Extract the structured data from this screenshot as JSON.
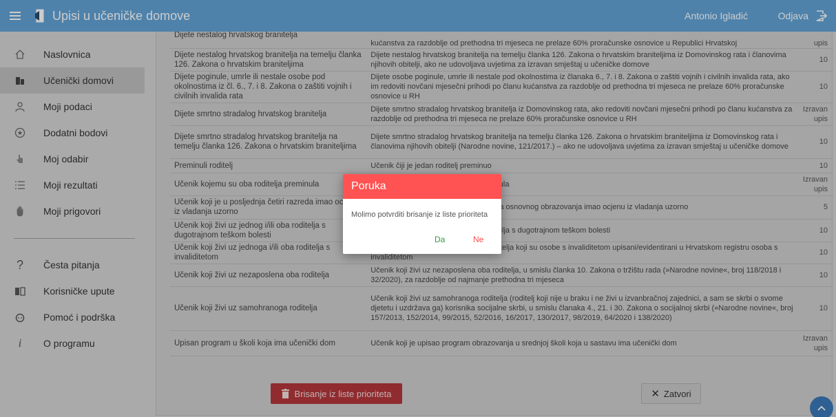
{
  "header": {
    "title": "Upisi u učeničke domove",
    "user": "Antonio Igladić",
    "logout": "Odjava"
  },
  "sidebar": {
    "items": [
      {
        "label": "Naslovnica",
        "icon": "home-icon"
      },
      {
        "label": "Učenički domovi",
        "icon": "building-icon",
        "active": true
      },
      {
        "label": "Moji podaci",
        "icon": "user-icon"
      },
      {
        "label": "Dodatni bodovi",
        "icon": "star-shield-icon"
      },
      {
        "label": "Moj odabir",
        "icon": "hand-pointer-icon"
      },
      {
        "label": "Moji rezultati",
        "icon": "list-icon"
      },
      {
        "label": "Moji prigovori",
        "icon": "raised-hand-icon"
      },
      {
        "label": "Česta pitanja",
        "icon": "question-icon"
      },
      {
        "label": "Korisničke upute",
        "icon": "book-icon"
      },
      {
        "label": "Pomoć i podrška",
        "icon": "support-icon"
      },
      {
        "label": "O programu",
        "icon": "info-icon"
      }
    ]
  },
  "table": {
    "rows": [
      {
        "c1": "Dijete nestalog hrvatskog branitelja",
        "c2": "kućanstva za razdoblje od prethodna tri mjeseca ne prelaze 60% proračunske osnovice u Republici Hrvatskoj",
        "c3": "upis"
      },
      {
        "c1": "Dijete nestalog hrvatskog branitelja na temelju članka 126. Zakona o hrvatskim braniteljima",
        "c2": "Dijete nestalog hrvatskog branitelja na temelju članka 126. Zakona o hrvatskim braniteljima iz Domovinskog rata i članovima njihovih obitelji, ako ne udovoljava uvjetima za izravan smještaj u učeničke domove",
        "c3": "10"
      },
      {
        "c1": "Dijete poginule, umrle ili nestale osobe pod okolnostima iz čl. 6., 7. i 8. Zakona o zaštiti vojnih i civilnih invalida rata",
        "c2": "Dijete osobe poginule, umrle ili nestale pod okolnostima iz članaka 6., 7. i 8. Zakona o zaštiti vojnih i civilnih invalida rata, ako im redoviti novčani mjesečni prihodi po članu kućanstva za razdoblje od prethodna tri mjeseca ne prelaze 60% proračunske osnovice u RH",
        "c3": "10"
      },
      {
        "c1": "Dijete smrtno stradalog hrvatskog branitelja",
        "c2": "Dijete smrtno stradalog hrvatskog branitelja iz Domovinskog rata, ako redoviti novčani mjesečni prihodi po članu kućanstva za razdoblje od prethodna tri mjeseca ne prelaze 60% proračunske osnovice u RH",
        "c3": "Izravan upis"
      },
      {
        "c1": "Dijete smrtno stradalog hrvatskog branitelja na temelju članka 126. Zakona o hrvatskim braniteljima",
        "c2": "Dijete smrtno stradalog hrvatskog branitelja na temelju članka 126. Zakona o hrvatskim braniteljima iz Domovinskog rata i članovima njihovih obitelji (Narodne novine, 121/2017.) – ako ne udovoljava uvjetima za izravan smještaj u učeničke domove",
        "c3": "10"
      },
      {
        "c1": "Preminuli roditelj",
        "c2": "Učenik čiji je jedan roditelj preminuo",
        "c3": "10"
      },
      {
        "c1": "Učenik kojemu su oba roditelja preminula",
        "c2": "Učenik kojemu su oba roditelja preminula",
        "c3": "Izravan upis"
      },
      {
        "c1": "Učenik koji je u posljednja četiri razreda imao ocjenu iz vladanja uzorno",
        "c2": "Učenik koji je u posljednja četiri razreda osnovnog obrazovanja imao ocjenu iz vladanja uzorno",
        "c3": "5"
      },
      {
        "c1": "Učenik koji živi uz jednog i/ili oba roditelja s dugotrajnom teškom bolesti",
        "c2": "Učenik koji živi uz jednog i/ili oba roditelja s dugotrajnom teškom bolesti",
        "c3": "10"
      },
      {
        "c1": "Učenik koji živi uz jednoga i/ili oba roditelja s invaliditetom",
        "c2": "Učenik koji živi uz jednoga i/ili oba roditelja koji su osobe s invaliditetom upisani/evidentirani u Hrvatskom registru osoba s invaliditetom",
        "c3": "10"
      },
      {
        "c1": "Učenik koji živi uz nezaposlena oba roditelja",
        "c2": "Učenik koji živi uz nezaposlena oba roditelja, u smislu članka 10. Zakona o tržištu rada (»Narodne novine«, broj 118/2018 i 32/2020), za razdoblje od najmanje prethodna tri mjeseca",
        "c3": "10"
      },
      {
        "c1": "Učenik koji živi uz samohranoga roditelja",
        "c2": "Učenik koji živi uz samohranoga roditelja (roditelj koji nije u braku i ne živi u izvanbračnoj zajednici, a sam se skrbi o svome djetetu i uzdržava ga) korisnika socijalne skrbi, u smislu članaka 4., 21. i 30. Zakona o socijalnoj skrbi (»Narodne novine«, broj 157/2013, 152/2014, 99/2015, 52/2016, 16/2017, 130/2017, 98/2019, 64/2020 i 138/2020)",
        "c3": "10"
      },
      {
        "c1": "Upisan program u školi koja ima učenički dom",
        "c2": "Učenik koji je upisao program obrazovanja u srednjoj školi koja u sastavu ima učenički dom",
        "c3": "Izravan upis"
      }
    ]
  },
  "buttons": {
    "delete": "Brisanje iz liste prioriteta",
    "close": "Zatvori"
  },
  "dialog": {
    "title": "Poruka",
    "message": "Molimo potvrditi brisanje iz liste prioriteta",
    "yes": "Da",
    "no": "Ne"
  },
  "colors": {
    "header": "#62a3d6",
    "danger": "#ff5252",
    "delete_button": "#b4363b"
  }
}
